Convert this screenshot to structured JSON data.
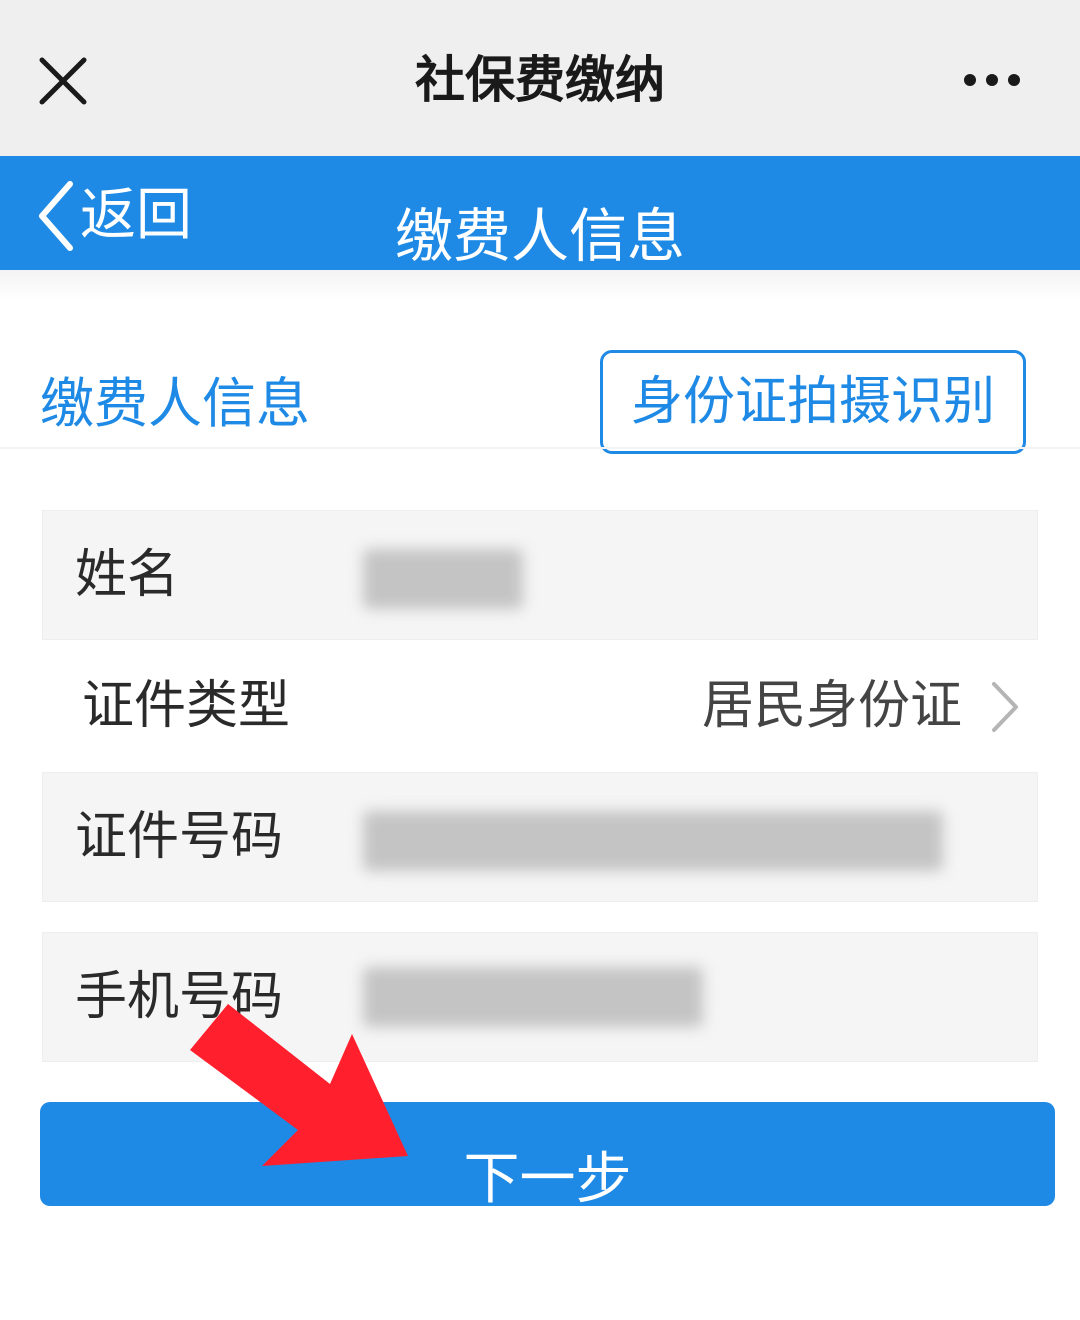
{
  "topbar": {
    "title": "社保费缴纳",
    "close_icon": "close-icon",
    "more_icon": "more-dots-icon"
  },
  "navbar": {
    "back_label": "返回",
    "title": "缴费人信息",
    "back_icon": "chevron-left-icon",
    "background_color": "#1e8ae5"
  },
  "section": {
    "title": "缴费人信息",
    "id_scan_button": "身份证拍摄识别"
  },
  "form": {
    "name_label": "姓名",
    "id_type_label": "证件类型",
    "id_type_value": "居民身份证",
    "id_number_label": "证件号码",
    "phone_label": "手机号码"
  },
  "next_button": "下一步",
  "annotation": {
    "arrow_color": "#ff1f2d",
    "arrow_icon": "red-pointer-arrow-icon"
  },
  "colors": {
    "accent": "#1e8ae5",
    "field_background": "#f5f5f5",
    "topbar_background": "#efefef"
  }
}
